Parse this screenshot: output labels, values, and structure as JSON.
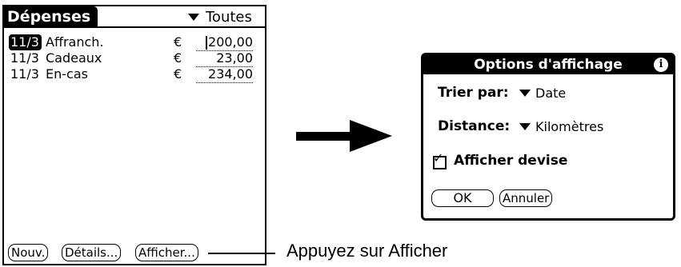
{
  "app": {
    "title": "Dépenses",
    "category_label": "Toutes"
  },
  "expenses": [
    {
      "date": "11/3",
      "description": "Affranch.",
      "currency": "€",
      "amount": "200,00",
      "selected": true
    },
    {
      "date": "11/3",
      "description": "Cadeaux",
      "currency": "€",
      "amount": "23,00",
      "selected": false
    },
    {
      "date": "11/3",
      "description": "En-cas",
      "currency": "€",
      "amount": "234,00",
      "selected": false
    }
  ],
  "buttons": {
    "new": "Nouv.",
    "details": "Détails...",
    "show": "Afficher..."
  },
  "dialog": {
    "title": "Options d'affichage",
    "info_icon": "i",
    "sort_label": "Trier par:",
    "sort_value": "Date",
    "distance_label": "Distance:",
    "distance_value": "Kilomètres",
    "show_currency_label": "Afficher devise",
    "show_currency_checked": true,
    "ok": "OK",
    "cancel": "Annuler"
  },
  "callout": "Appuyez sur Afficher",
  "icons": {
    "arrow": "right-arrow-icon",
    "dropdown": "triangle-down-icon",
    "info": "info-icon",
    "check": "checkmark-icon"
  }
}
